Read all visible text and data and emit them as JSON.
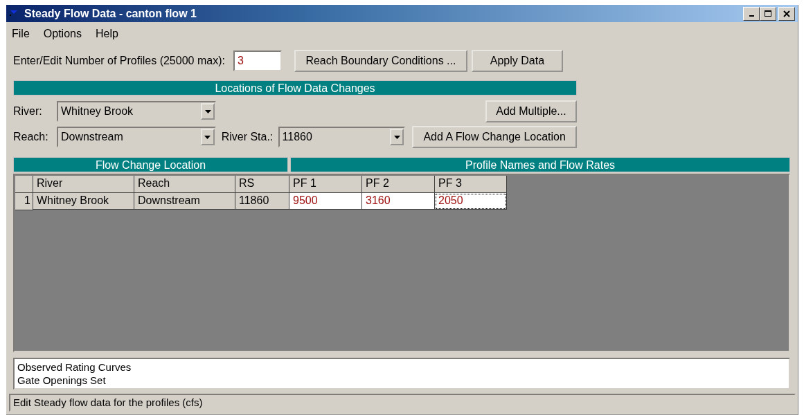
{
  "window": {
    "title": "Steady Flow Data - canton flow 1"
  },
  "menu": [
    "File",
    "Options",
    "Help"
  ],
  "profiles": {
    "label": "Enter/Edit Number of Profiles (25000 max):",
    "value": "3"
  },
  "top_buttons": [
    "Reach Boundary Conditions ...",
    "Apply Data"
  ],
  "locations": {
    "title": "Locations of Flow Data Changes",
    "river": {
      "label": "River:",
      "value": "Whitney Brook"
    },
    "reach": {
      "label": "Reach:",
      "value": "Downstream"
    },
    "river_station": {
      "label": "River Sta.:",
      "value": "11860"
    },
    "add_multiple": "Add Multiple...",
    "add_location": "Add A Flow Change Location"
  },
  "table": {
    "group_headers": [
      "Flow Change Location",
      "Profile Names and Flow Rates"
    ],
    "columns": [
      {
        "label": "River",
        "kind": "location"
      },
      {
        "label": "Reach",
        "kind": "location"
      },
      {
        "label": "RS",
        "kind": "location"
      },
      {
        "label": "PF 1",
        "kind": "flow"
      },
      {
        "label": "PF 2",
        "kind": "flow"
      },
      {
        "label": "PF 3",
        "kind": "flow"
      }
    ],
    "rows": [
      {
        "number": "1",
        "cells": [
          {
            "text": "Whitney Brook",
            "focused": false
          },
          {
            "text": "Downstream",
            "focused": false
          },
          {
            "text": "11860",
            "focused": false
          },
          {
            "text": "9500",
            "focused": false
          },
          {
            "text": "3160",
            "focused": false
          },
          {
            "text": "2050",
            "focused": true
          }
        ]
      }
    ]
  },
  "notes": [
    "Observed Rating Curves",
    "Gate Openings Set"
  ],
  "status_bar": "Edit Steady flow data for the profiles (cfs)"
}
